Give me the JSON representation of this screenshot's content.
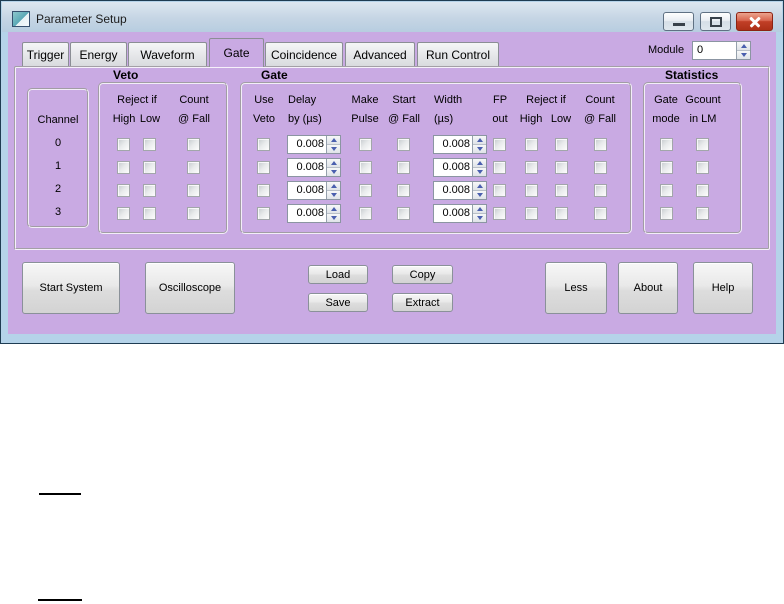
{
  "window": {
    "title": "Parameter Setup"
  },
  "module": {
    "label": "Module",
    "value": "0"
  },
  "tabs": [
    "Trigger",
    "Energy",
    "Waveform",
    "Gate",
    "Coincidence",
    "Advanced",
    "Run Control"
  ],
  "active_tab": "Gate",
  "channel": {
    "label": "Channel",
    "values": [
      "0",
      "1",
      "2",
      "3"
    ]
  },
  "veto": {
    "title": "Veto",
    "headers": {
      "reject_if": "Reject if",
      "high": "High",
      "low": "Low",
      "count": "Count",
      "at_fall": "@ Fall"
    }
  },
  "gate": {
    "title": "Gate",
    "headers": {
      "use_1": "Use",
      "use_2": "Veto",
      "delay_1": "Delay",
      "delay_2": "by (µs)",
      "make_1": "Make",
      "make_2": "Pulse",
      "start_1": "Start",
      "start_2": "@ Fall",
      "width_1": "Width",
      "width_2": "(µs)",
      "fp_1": "FP",
      "fp_2": "out",
      "reject_if": "Reject if",
      "high": "High",
      "low": "Low",
      "count": "Count",
      "at_fall": "@ Fall"
    },
    "rows": [
      {
        "delay": "0.008",
        "width": "0.008"
      },
      {
        "delay": "0.008",
        "width": "0.008"
      },
      {
        "delay": "0.008",
        "width": "0.008"
      },
      {
        "delay": "0.008",
        "width": "0.008"
      }
    ]
  },
  "statistics": {
    "title": "Statistics",
    "headers": {
      "gate_1": "Gate",
      "gate_2": "mode",
      "gcount_1": "Gcount",
      "gcount_2": "in LM"
    }
  },
  "buttons": {
    "start_system": "Start System",
    "oscilloscope": "Oscilloscope",
    "load": "Load",
    "save": "Save",
    "copy": "Copy",
    "extract": "Extract",
    "less": "Less",
    "about": "About",
    "help": "Help"
  },
  "colors": {
    "dialog_bg": "#c9aae3",
    "frame_blue": "#b5d3e9",
    "titlebar_top": "#dde7f0",
    "titlebar_bottom": "#b7cde0",
    "close_red": "#c13f27",
    "spin_arrow": "#4a5fae"
  }
}
